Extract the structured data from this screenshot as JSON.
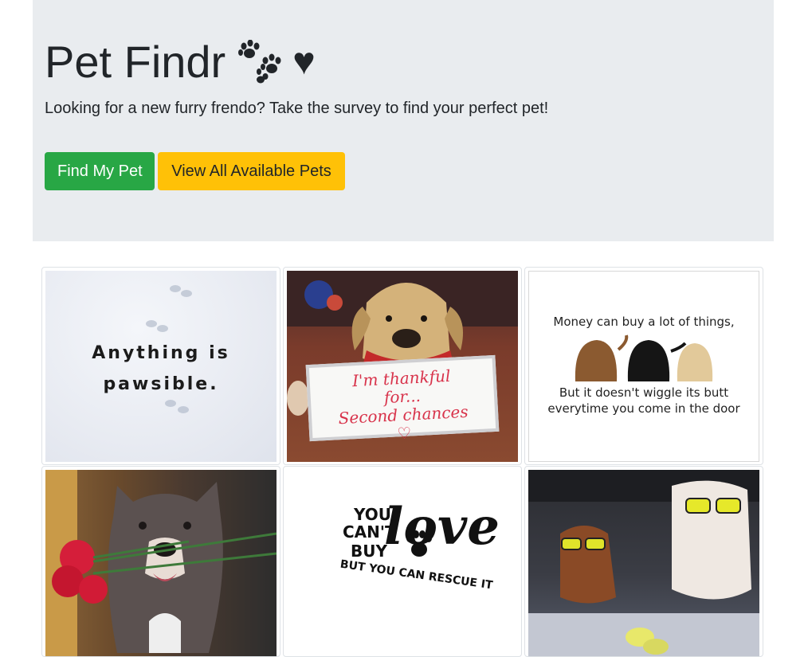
{
  "header": {
    "title": "Pet Findr",
    "heart": "♥",
    "lead": "Looking for a new furry frendo? Take the survey to find your perfect pet!",
    "find_button": "Find My Pet",
    "view_button": "View All Available Pets"
  },
  "colors": {
    "jumbotron_bg": "#e9ecef",
    "find_button": "#28a745",
    "view_button": "#ffc107"
  },
  "gallery": {
    "tile1": {
      "line1": "Anything is",
      "line2": "pawsible."
    },
    "tile2": {
      "line1": "I'm thankful",
      "line2": "for...",
      "line3": "Second chances"
    },
    "tile3": {
      "top": "Money can buy a lot of things,",
      "bottom1": "But it doesn't wiggle its butt",
      "bottom2": "everytime you come in the door"
    },
    "tile5": {
      "you": "YOU",
      "cant": "CAN'T",
      "buy": "BUY",
      "love": "love",
      "rescue": "BUT YOU CAN RESCUE IT"
    }
  }
}
